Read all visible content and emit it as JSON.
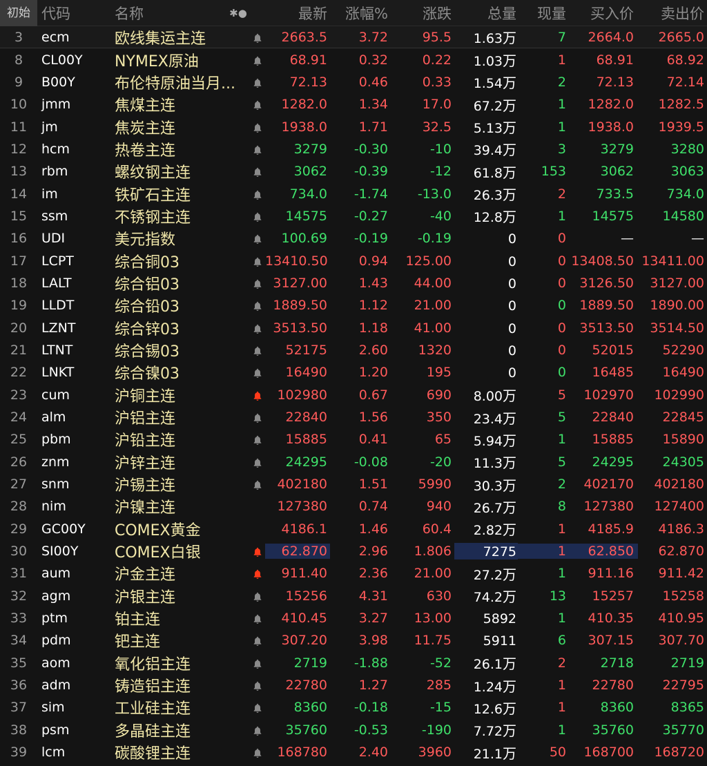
{
  "header": {
    "no": "初始",
    "code": "代码",
    "name": "名称",
    "icons": "✱●",
    "last": "最新",
    "pct": "涨幅%",
    "chg": "涨跌",
    "vol": "总量",
    "cur": "现量",
    "bid": "买入价",
    "ask": "卖出价"
  },
  "colors": {
    "up": "#ff5a5a",
    "down": "#3fe06a",
    "name": "#f0e6a8",
    "alert_bell": "#ff3a1a",
    "bell": "#8a8a8a",
    "highlight": "#1d2b52"
  },
  "rows": [
    {
      "no": "3",
      "code": "ecm",
      "name": "欧线集运主连",
      "bell": "normal",
      "last": "2663.5",
      "pct": "3.72",
      "chg": "95.5",
      "vol": "1.63",
      "unit": "万",
      "cur": "7",
      "bid": "2664.0",
      "ask": "2665.0",
      "dir": "up",
      "cur_dir": "down"
    },
    {
      "no": "8",
      "code": "CL00Y",
      "name": "NYMEX原油",
      "bell": "normal",
      "last": "68.91",
      "pct": "0.32",
      "chg": "0.22",
      "vol": "1.03",
      "unit": "万",
      "cur": "1",
      "bid": "68.91",
      "ask": "68.92",
      "dir": "up",
      "cur_dir": "up"
    },
    {
      "no": "9",
      "code": "B00Y",
      "name": "布伦特原油当月...",
      "bell": "normal",
      "last": "72.13",
      "pct": "0.46",
      "chg": "0.33",
      "vol": "1.54",
      "unit": "万",
      "cur": "2",
      "bid": "72.13",
      "ask": "72.14",
      "dir": "up",
      "cur_dir": "down"
    },
    {
      "no": "10",
      "code": "jmm",
      "name": "焦煤主连",
      "bell": "normal",
      "last": "1282.0",
      "pct": "1.34",
      "chg": "17.0",
      "vol": "67.2",
      "unit": "万",
      "cur": "1",
      "bid": "1282.0",
      "ask": "1282.5",
      "dir": "up",
      "cur_dir": "down"
    },
    {
      "no": "11",
      "code": "jm",
      "name": "焦炭主连",
      "bell": "normal",
      "last": "1938.0",
      "pct": "1.71",
      "chg": "32.5",
      "vol": "5.13",
      "unit": "万",
      "cur": "1",
      "bid": "1938.0",
      "ask": "1939.5",
      "dir": "up",
      "cur_dir": "down"
    },
    {
      "no": "12",
      "code": "hcm",
      "name": "热卷主连",
      "bell": "normal",
      "last": "3279",
      "pct": "-0.30",
      "chg": "-10",
      "vol": "39.4",
      "unit": "万",
      "cur": "3",
      "bid": "3279",
      "ask": "3280",
      "dir": "down",
      "cur_dir": "down"
    },
    {
      "no": "13",
      "code": "rbm",
      "name": "螺纹钢主连",
      "bell": "normal",
      "last": "3062",
      "pct": "-0.39",
      "chg": "-12",
      "vol": "61.8",
      "unit": "万",
      "cur": "153",
      "bid": "3062",
      "ask": "3063",
      "dir": "down",
      "cur_dir": "down"
    },
    {
      "no": "14",
      "code": "im",
      "name": "铁矿石主连",
      "bell": "normal",
      "last": "734.0",
      "pct": "-1.74",
      "chg": "-13.0",
      "vol": "26.3",
      "unit": "万",
      "cur": "2",
      "bid": "733.5",
      "ask": "734.0",
      "dir": "down",
      "cur_dir": "up"
    },
    {
      "no": "15",
      "code": "ssm",
      "name": "不锈钢主连",
      "bell": "normal",
      "last": "14575",
      "pct": "-0.27",
      "chg": "-40",
      "vol": "12.8",
      "unit": "万",
      "cur": "1",
      "bid": "14575",
      "ask": "14580",
      "dir": "down",
      "cur_dir": "down"
    },
    {
      "no": "16",
      "code": "UDI",
      "name": "美元指数",
      "bell": "normal",
      "last": "100.69",
      "pct": "-0.19",
      "chg": "-0.19",
      "vol": "0",
      "unit": "",
      "cur": "0",
      "bid": "—",
      "ask": "—",
      "dir": "down",
      "cur_dir": "up"
    },
    {
      "no": "17",
      "code": "LCPT",
      "name": "综合铜03",
      "bell": "normal",
      "last": "13410.50",
      "pct": "0.94",
      "chg": "125.00",
      "vol": "0",
      "unit": "",
      "cur": "0",
      "bid": "13408.50",
      "ask": "13411.00",
      "dir": "up",
      "cur_dir": "up"
    },
    {
      "no": "18",
      "code": "LALT",
      "name": "综合铝03",
      "bell": "normal",
      "last": "3127.00",
      "pct": "1.43",
      "chg": "44.00",
      "vol": "0",
      "unit": "",
      "cur": "0",
      "bid": "3126.50",
      "ask": "3127.00",
      "dir": "up",
      "cur_dir": "up"
    },
    {
      "no": "19",
      "code": "LLDT",
      "name": "综合铅03",
      "bell": "normal",
      "last": "1889.50",
      "pct": "1.12",
      "chg": "21.00",
      "vol": "0",
      "unit": "",
      "cur": "0",
      "bid": "1889.50",
      "ask": "1890.00",
      "dir": "up",
      "cur_dir": "down"
    },
    {
      "no": "20",
      "code": "LZNT",
      "name": "综合锌03",
      "bell": "normal",
      "last": "3513.50",
      "pct": "1.18",
      "chg": "41.00",
      "vol": "0",
      "unit": "",
      "cur": "0",
      "bid": "3513.50",
      "ask": "3514.50",
      "dir": "up",
      "cur_dir": "up"
    },
    {
      "no": "21",
      "code": "LTNT",
      "name": "综合锡03",
      "bell": "normal",
      "last": "52175",
      "pct": "2.60",
      "chg": "1320",
      "vol": "0",
      "unit": "",
      "cur": "0",
      "bid": "52015",
      "ask": "52290",
      "dir": "up",
      "cur_dir": "up"
    },
    {
      "no": "22",
      "code": "LNKT",
      "name": "综合镍03",
      "bell": "normal",
      "last": "16490",
      "pct": "1.20",
      "chg": "195",
      "vol": "0",
      "unit": "",
      "cur": "0",
      "bid": "16485",
      "ask": "16490",
      "dir": "up",
      "cur_dir": "down"
    },
    {
      "no": "23",
      "code": "cum",
      "name": "沪铜主连",
      "bell": "alert",
      "last": "102980",
      "pct": "0.67",
      "chg": "690",
      "vol": "8.00",
      "unit": "万",
      "cur": "5",
      "bid": "102970",
      "ask": "102990",
      "dir": "up",
      "cur_dir": "up"
    },
    {
      "no": "24",
      "code": "alm",
      "name": "沪铝主连",
      "bell": "normal",
      "last": "22840",
      "pct": "1.56",
      "chg": "350",
      "vol": "23.4",
      "unit": "万",
      "cur": "5",
      "bid": "22840",
      "ask": "22845",
      "dir": "up",
      "cur_dir": "down"
    },
    {
      "no": "25",
      "code": "pbm",
      "name": "沪铅主连",
      "bell": "normal",
      "last": "15885",
      "pct": "0.41",
      "chg": "65",
      "vol": "5.94",
      "unit": "万",
      "cur": "1",
      "bid": "15885",
      "ask": "15890",
      "dir": "up",
      "cur_dir": "down"
    },
    {
      "no": "26",
      "code": "znm",
      "name": "沪锌主连",
      "bell": "normal",
      "last": "24295",
      "pct": "-0.08",
      "chg": "-20",
      "vol": "11.3",
      "unit": "万",
      "cur": "5",
      "bid": "24295",
      "ask": "24305",
      "dir": "down",
      "cur_dir": "down"
    },
    {
      "no": "27",
      "code": "snm",
      "name": "沪锡主连",
      "bell": "normal",
      "last": "402180",
      "pct": "1.51",
      "chg": "5990",
      "vol": "30.3",
      "unit": "万",
      "cur": "2",
      "bid": "402170",
      "ask": "402180",
      "dir": "up",
      "cur_dir": "down"
    },
    {
      "no": "28",
      "code": "nim",
      "name": "沪镍主连",
      "bell": "none",
      "last": "127380",
      "pct": "0.74",
      "chg": "940",
      "vol": "26.7",
      "unit": "万",
      "cur": "8",
      "bid": "127380",
      "ask": "127400",
      "dir": "up",
      "cur_dir": "down"
    },
    {
      "no": "29",
      "code": "GC00Y",
      "name": "COMEX黄金",
      "bell": "none",
      "last": "4186.1",
      "pct": "1.46",
      "chg": "60.4",
      "vol": "2.82",
      "unit": "万",
      "cur": "1",
      "bid": "4185.9",
      "ask": "4186.3",
      "dir": "up",
      "cur_dir": "up"
    },
    {
      "no": "30",
      "code": "SI00Y",
      "name": "COMEX白银",
      "bell": "alert",
      "last": "62.870",
      "pct": "2.96",
      "chg": "1.806",
      "vol": "7275",
      "unit": "",
      "cur": "1",
      "bid": "62.850",
      "ask": "62.870",
      "dir": "up",
      "cur_dir": "up",
      "highlight": true
    },
    {
      "no": "31",
      "code": "aum",
      "name": "沪金主连",
      "bell": "alert",
      "last": "911.40",
      "pct": "2.36",
      "chg": "21.00",
      "vol": "27.2",
      "unit": "万",
      "cur": "1",
      "bid": "911.16",
      "ask": "911.42",
      "dir": "up",
      "cur_dir": "down"
    },
    {
      "no": "32",
      "code": "agm",
      "name": "沪银主连",
      "bell": "normal",
      "last": "15256",
      "pct": "4.31",
      "chg": "630",
      "vol": "74.2",
      "unit": "万",
      "cur": "13",
      "bid": "15257",
      "ask": "15258",
      "dir": "up",
      "cur_dir": "down"
    },
    {
      "no": "33",
      "code": "ptm",
      "name": "铂主连",
      "bell": "normal",
      "last": "410.45",
      "pct": "3.27",
      "chg": "13.00",
      "vol": "5892",
      "unit": "",
      "cur": "1",
      "bid": "410.35",
      "ask": "410.95",
      "dir": "up",
      "cur_dir": "down"
    },
    {
      "no": "34",
      "code": "pdm",
      "name": "钯主连",
      "bell": "normal",
      "last": "307.20",
      "pct": "3.98",
      "chg": "11.75",
      "vol": "5911",
      "unit": "",
      "cur": "6",
      "bid": "307.15",
      "ask": "307.70",
      "dir": "up",
      "cur_dir": "down"
    },
    {
      "no": "35",
      "code": "aom",
      "name": "氧化铝主连",
      "bell": "normal",
      "last": "2719",
      "pct": "-1.88",
      "chg": "-52",
      "vol": "26.1",
      "unit": "万",
      "cur": "2",
      "bid": "2718",
      "ask": "2719",
      "dir": "down",
      "cur_dir": "up"
    },
    {
      "no": "36",
      "code": "adm",
      "name": "铸造铝主连",
      "bell": "normal",
      "last": "22780",
      "pct": "1.27",
      "chg": "285",
      "vol": "1.24",
      "unit": "万",
      "cur": "1",
      "bid": "22780",
      "ask": "22795",
      "dir": "up",
      "cur_dir": "up"
    },
    {
      "no": "37",
      "code": "sim",
      "name": "工业硅主连",
      "bell": "normal",
      "last": "8360",
      "pct": "-0.18",
      "chg": "-15",
      "vol": "12.6",
      "unit": "万",
      "cur": "1",
      "bid": "8360",
      "ask": "8365",
      "dir": "down",
      "cur_dir": "up"
    },
    {
      "no": "38",
      "code": "psm",
      "name": "多晶硅主连",
      "bell": "normal",
      "last": "35760",
      "pct": "-0.53",
      "chg": "-190",
      "vol": "7.72",
      "unit": "万",
      "cur": "1",
      "bid": "35760",
      "ask": "35770",
      "dir": "down",
      "cur_dir": "down"
    },
    {
      "no": "39",
      "code": "lcm",
      "name": "碳酸锂主连",
      "bell": "normal",
      "last": "168780",
      "pct": "2.40",
      "chg": "3960",
      "vol": "21.1",
      "unit": "万",
      "cur": "50",
      "bid": "168700",
      "ask": "168720",
      "dir": "up",
      "cur_dir": "up"
    }
  ]
}
